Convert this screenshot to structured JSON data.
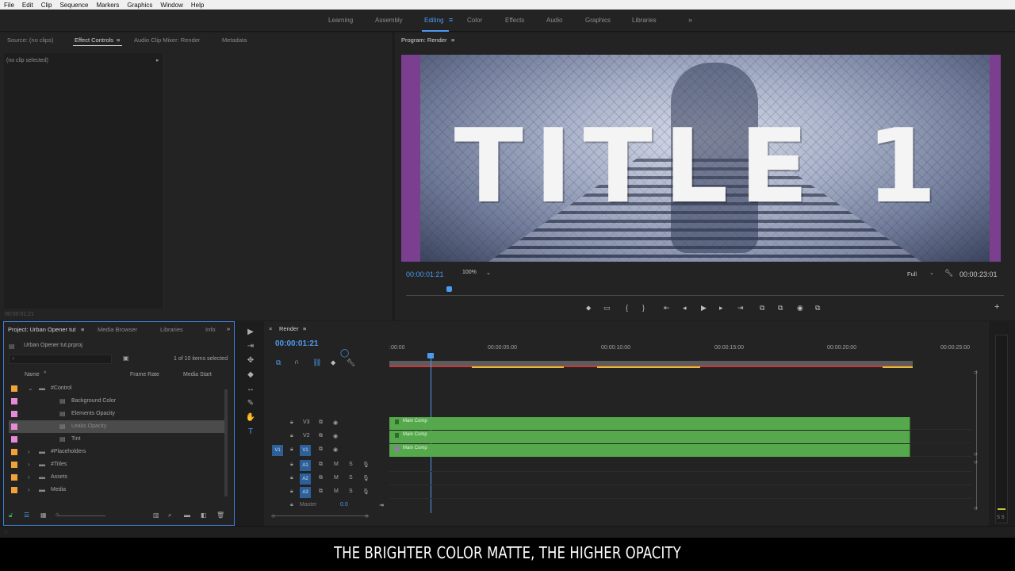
{
  "menu": [
    "File",
    "Edit",
    "Clip",
    "Sequence",
    "Markers",
    "Graphics",
    "Window",
    "Help"
  ],
  "workspaces": {
    "items": [
      "Learning",
      "Assembly",
      "Editing",
      "Color",
      "Effects",
      "Audio",
      "Graphics",
      "Libraries"
    ],
    "active": "Editing",
    "menu_icon": "≡",
    "more_icon": "»"
  },
  "source_panel": {
    "tabs": [
      "Source: (no clips)",
      "Effect Controls",
      "Audio Clip Mixer: Render",
      "Metadata"
    ],
    "menu_icon": "≡",
    "no_clip": "(no clip selected)",
    "timecode": "00:00:01:21"
  },
  "program": {
    "tab": "Program: Render",
    "menu_icon": "≡",
    "title_text": "TITLE 1",
    "timecode": "00:00:01:21",
    "zoom": "100%",
    "resolution": "Full",
    "duration": "00:00:23:01",
    "controls": [
      "⬥",
      "▭",
      "{",
      "}",
      "⇤",
      "◂",
      "▶",
      "▸",
      "⇥",
      "⧉",
      "⧉",
      "◉",
      "⧉"
    ],
    "add_icon": "+"
  },
  "project": {
    "tabs": [
      "Project: Urban Opener tut",
      "Media Browser",
      "Libraries",
      "Info"
    ],
    "menu_icon": "≡",
    "more_icon": "»",
    "file": "Urban Opener tut.prproj",
    "selection": "1 of 10 items selected",
    "columns": [
      "Name",
      "Frame Rate",
      "Media Start"
    ],
    "items": [
      {
        "label": "#Control",
        "color": "#f0a23a",
        "kind": "folder",
        "open": true,
        "indent": 0
      },
      {
        "label": "Background Color",
        "color": "#e58ad6",
        "kind": "clip",
        "indent": 1
      },
      {
        "label": "Elements Opacity",
        "color": "#e58ad6",
        "kind": "clip",
        "indent": 1
      },
      {
        "label": "Leaks Opacity",
        "color": "#e58ad6",
        "kind": "clip",
        "indent": 1,
        "selected": true
      },
      {
        "label": "Tint",
        "color": "#e58ad6",
        "kind": "clip",
        "indent": 1
      },
      {
        "label": "#Placeholders",
        "color": "#f0a23a",
        "kind": "folder",
        "indent": 0
      },
      {
        "label": "#Titles",
        "color": "#f0a23a",
        "kind": "folder",
        "indent": 0
      },
      {
        "label": "Assets",
        "color": "#f0a23a",
        "kind": "folder",
        "indent": 0
      },
      {
        "label": "Media",
        "color": "#f0a23a",
        "kind": "folder",
        "indent": 0
      }
    ]
  },
  "tools": [
    "▶",
    "⇥",
    "✥",
    "◆",
    "↔",
    "✎",
    "✋",
    "T"
  ],
  "timeline": {
    "tab": "Render",
    "menu_icon": "≡",
    "close_icon": "×",
    "timecode": "00:00:01:21",
    "ruler": [
      ":00:00",
      "00:00:05:00",
      "00:00:10:00",
      "00:00:15:00",
      "00:00:20:00",
      "00:00:25:00"
    ],
    "video_tracks": [
      {
        "name": "V3",
        "clip": "Main Comp"
      },
      {
        "name": "V2",
        "clip": "Main Comp"
      },
      {
        "name": "V1",
        "clip": "Main Comp",
        "source": "V1"
      }
    ],
    "audio_tracks": [
      "A1",
      "A2",
      "A3"
    ],
    "master_label": "Master",
    "master_value": "0.0",
    "meter_scale": "S S"
  },
  "subtitle": "THE BRIGHTER COLOR MATTE, THE HIGHER OPACITY",
  "colors": {
    "accent": "#4d9bf0",
    "clip_green": "#55a94c",
    "panel_bg": "#232323",
    "border_select": "#3d7fd6"
  }
}
